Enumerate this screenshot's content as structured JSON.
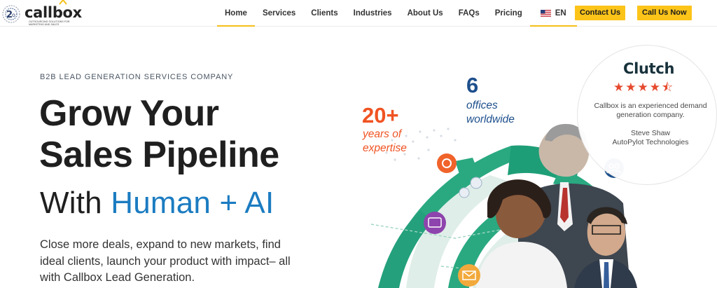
{
  "header": {
    "logo_text": "callbox",
    "logo_tagline": "OUTSOURCING SOLUTIONS FOR MARKETING AND SALES",
    "nav": [
      {
        "label": "Home",
        "active": true
      },
      {
        "label": "Services"
      },
      {
        "label": "Clients"
      },
      {
        "label": "Industries"
      },
      {
        "label": "About Us"
      },
      {
        "label": "FAQs"
      },
      {
        "label": "Pricing"
      }
    ],
    "language": "EN",
    "contact_label": "Contact Us",
    "call_label": "Call Us Now",
    "accent_color": "#fcc419"
  },
  "hero": {
    "eyebrow": "B2B LEAD GENERATION SERVICES COMPANY",
    "headline_line1": "Grow Your",
    "headline_line2": "Sales Pipeline",
    "subhead_prefix": "With ",
    "subhead_accent": "Human + AI",
    "description": "Close more deals, expand to new markets, find ideal clients, launch your product with impact– all with Callbox Lead Generation.",
    "accent_color": "#1b7cc1"
  },
  "stats": {
    "years_value": "20+",
    "years_label_1": "years of",
    "years_label_2": "expertise",
    "offices_value": "6",
    "offices_label_1": "offices",
    "offices_label_2": "worldwide"
  },
  "clutch": {
    "logo": "Clutch",
    "stars": "★★★★⯪",
    "rating": 4.5,
    "quote": "Callbox is an experienced demand generation company.",
    "reviewer": "Steve Shaw",
    "company": "AutoPylot Technologies"
  },
  "icons": [
    "callbox-logo-icon",
    "us-flag-icon",
    "support-icon",
    "group-icon",
    "chat-icon",
    "mail-icon",
    "user-icon"
  ]
}
